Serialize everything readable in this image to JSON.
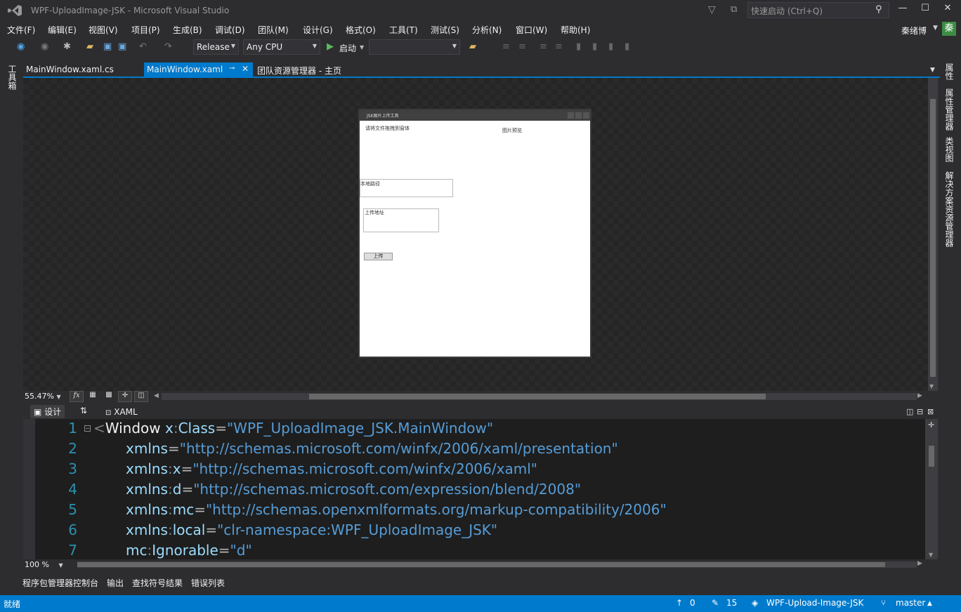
{
  "window": {
    "title": "WPF-UploadImage-JSK - Microsoft Visual Studio"
  },
  "quick_launch": {
    "placeholder": "快速启动 (Ctrl+Q)"
  },
  "menu": [
    "文件(F)",
    "编辑(E)",
    "视图(V)",
    "项目(P)",
    "生成(B)",
    "调试(D)",
    "团队(M)",
    "设计(G)",
    "格式(O)",
    "工具(T)",
    "测试(S)",
    "分析(N)",
    "窗口(W)",
    "帮助(H)"
  ],
  "user": {
    "name": "秦绪博",
    "avatar": "秦"
  },
  "toolbar": {
    "config": "Release",
    "platform": "Any CPU",
    "start": "启动"
  },
  "tabs": [
    "MainWindow.xaml.cs",
    "MainWindow.xaml",
    "团队资源管理器 - 主页"
  ],
  "left_rail": {
    "toolbox": "工具箱"
  },
  "right_rail": [
    "属性",
    "属性管理器",
    "类视图",
    "解决方案资源管理器"
  ],
  "preview": {
    "title": "JSK图片上传工具",
    "drop_hint": "请将文件拖拽到窗体",
    "preview_label": "图片预览",
    "local_path": "本地路径",
    "upload_url": "上传地址",
    "upload_button": "上传"
  },
  "designer": {
    "zoom": "55.47%",
    "fx": "fx"
  },
  "split": {
    "design": "设计",
    "swap": "⇅",
    "xaml": "XAML"
  },
  "code_lines": [
    {
      "n": "1",
      "parts": [
        [
          "pu",
          "<"
        ],
        [
          "kw",
          "Window "
        ],
        [
          "at",
          "x"
        ],
        [
          "pu",
          ":"
        ],
        [
          "at",
          "Class"
        ],
        [
          "eq",
          "="
        ],
        [
          "str",
          "\"WPF_UploadImage_JSK.MainWindow\""
        ]
      ]
    },
    {
      "n": "2",
      "parts": [
        [
          "at",
          "xmlns"
        ],
        [
          "eq",
          "="
        ],
        [
          "str",
          "\"http://schemas.microsoft.com/winfx/2006/xaml/presentation\""
        ]
      ]
    },
    {
      "n": "3",
      "parts": [
        [
          "at",
          "xmlns"
        ],
        [
          "pu",
          ":"
        ],
        [
          "at",
          "x"
        ],
        [
          "eq",
          "="
        ],
        [
          "str",
          "\"http://schemas.microsoft.com/winfx/2006/xaml\""
        ]
      ]
    },
    {
      "n": "4",
      "parts": [
        [
          "at",
          "xmlns"
        ],
        [
          "pu",
          ":"
        ],
        [
          "at",
          "d"
        ],
        [
          "eq",
          "="
        ],
        [
          "str",
          "\"http://schemas.microsoft.com/expression/blend/2008\""
        ]
      ]
    },
    {
      "n": "5",
      "parts": [
        [
          "at",
          "xmlns"
        ],
        [
          "pu",
          ":"
        ],
        [
          "at",
          "mc"
        ],
        [
          "eq",
          "="
        ],
        [
          "str",
          "\"http://schemas.openxmlformats.org/markup-compatibility/2006\""
        ]
      ]
    },
    {
      "n": "6",
      "parts": [
        [
          "at",
          "xmlns"
        ],
        [
          "pu",
          ":"
        ],
        [
          "at",
          "local"
        ],
        [
          "eq",
          "="
        ],
        [
          "str",
          "\"clr-namespace:WPF_UploadImage_JSK\""
        ]
      ]
    },
    {
      "n": "7",
      "parts": [
        [
          "at",
          "mc"
        ],
        [
          "pu",
          ":"
        ],
        [
          "at",
          "Ignorable"
        ],
        [
          "eq",
          "="
        ],
        [
          "str",
          "\"d\""
        ]
      ]
    }
  ],
  "editor": {
    "zoom": "100 %"
  },
  "bottom_tabs": [
    "程序包管理器控制台",
    "输出",
    "查找符号结果",
    "错误列表"
  ],
  "status": {
    "ready": "就绪",
    "up": "0",
    "edits": "15",
    "repo": "WPF-Upload-Image-JSK",
    "branch": "master"
  }
}
